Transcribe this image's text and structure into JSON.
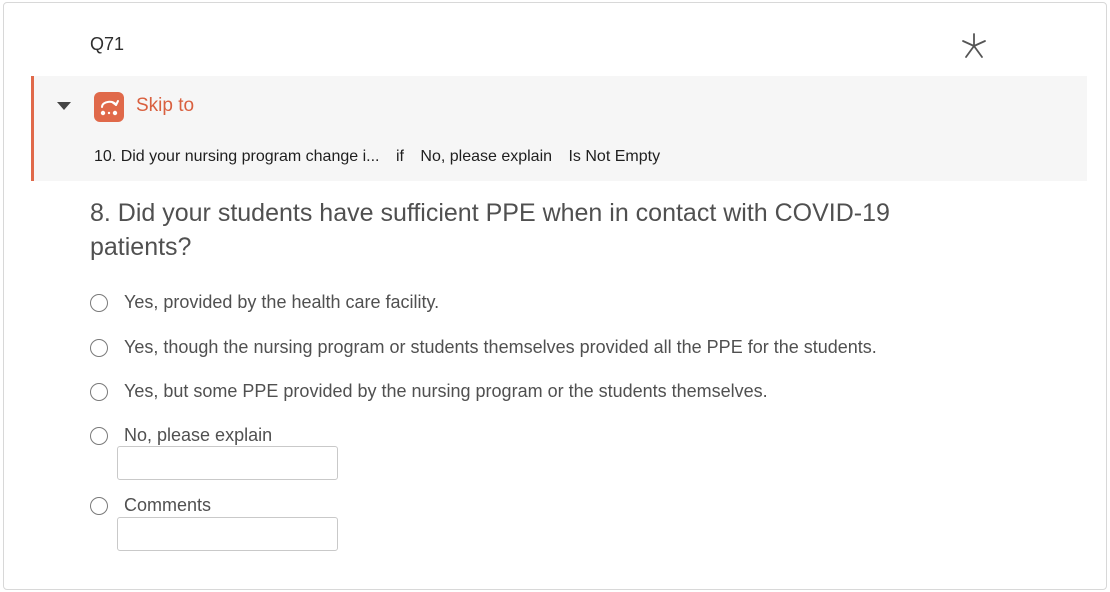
{
  "question": {
    "id": "Q71",
    "text": "8. Did your students have sufficient PPE when in contact with COVID-19 patients?",
    "required_icon": "asterisk-icon"
  },
  "skip_logic": {
    "label": "Skip to",
    "icon": "skip-to-icon",
    "accent_color": "#e0694a",
    "rule": {
      "target": "10. Did your nursing program change i...",
      "operator": "if",
      "choice": "No, please explain",
      "condition": "Is Not Empty"
    }
  },
  "choices": [
    {
      "label": "Yes, provided by the health care facility."
    },
    {
      "label": "Yes, though the nursing program or students themselves provided all the PPE for the students."
    },
    {
      "label": "Yes, but some PPE provided by the nursing program or the students themselves."
    },
    {
      "label": "No, please explain",
      "text_entry": {
        "value": "",
        "placeholder": ""
      }
    },
    {
      "label": "Comments",
      "text_entry": {
        "value": "",
        "placeholder": ""
      }
    }
  ]
}
